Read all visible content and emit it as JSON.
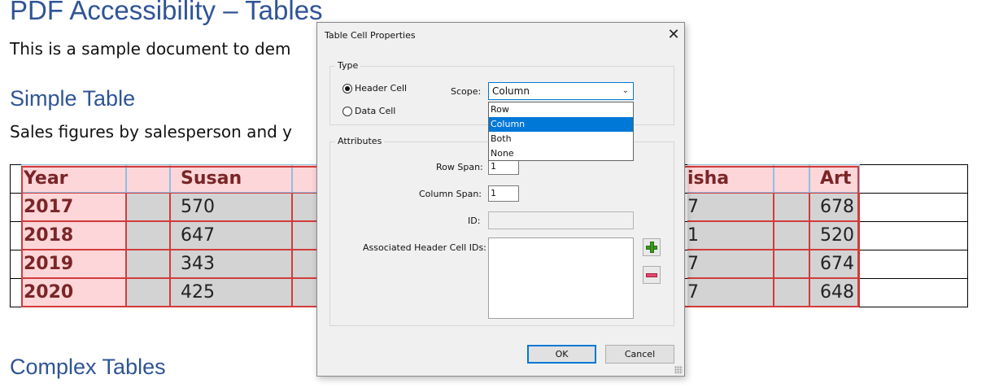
{
  "document": {
    "title": "PDF Accessibility – Tables",
    "intro": "This is a sample document to dem",
    "simple_heading": "Simple Table",
    "simple_caption": "Sales figures by salesperson and y",
    "complex_heading": "Complex Tables",
    "table": {
      "headers": [
        "Year",
        "Susan",
        "isha",
        "Art"
      ],
      "rows": [
        {
          "year": "2017",
          "susan": "570",
          "isha": "7",
          "art": "678"
        },
        {
          "year": "2018",
          "susan": "647",
          "isha": "1",
          "art": "520"
        },
        {
          "year": "2019",
          "susan": "343",
          "isha": "7",
          "art": "674"
        },
        {
          "year": "2020",
          "susan": "425",
          "isha": "7",
          "art": "648"
        }
      ]
    }
  },
  "dialog": {
    "title": "Table Cell Properties",
    "close_glyph": "✕",
    "type_group": "Type",
    "header_cell": "Header Cell",
    "data_cell": "Data Cell",
    "scope_label": "Scope:",
    "scope_value": "Column",
    "scope_options": [
      "Row",
      "Column",
      "Both",
      "None"
    ],
    "attributes_group": "Attributes",
    "row_span_label": "Row Span:",
    "row_span_value": "1",
    "column_span_label": "Column Span:",
    "column_span_value": "1",
    "id_label": "ID:",
    "id_value": "",
    "assoc_label": "Associated Header Cell IDs:",
    "ok_label": "OK",
    "cancel_label": "Cancel"
  },
  "colors": {
    "heading_blue": "#2f5496",
    "header_fill": "#fcd6d9",
    "cell_fill": "#d3d3d3",
    "tag_red": "#d23b3b",
    "selection_blue": "#0078d7"
  }
}
